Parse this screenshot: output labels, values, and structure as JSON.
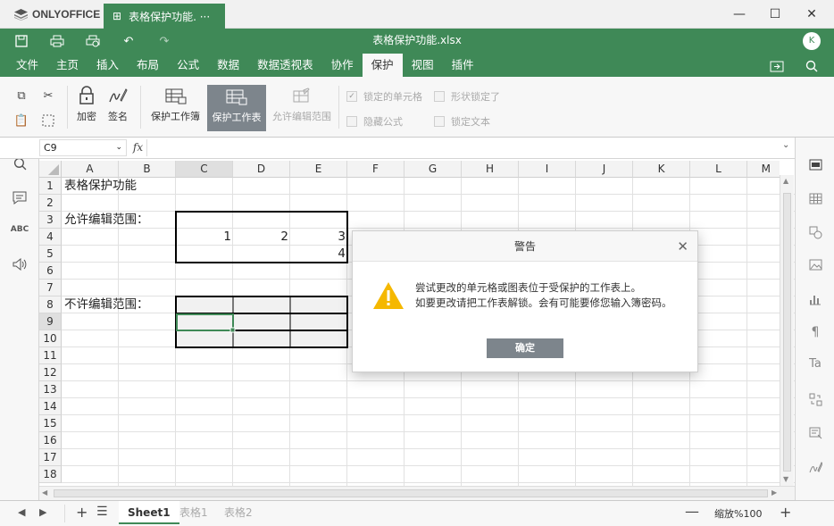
{
  "app": {
    "name": "ONLYOFFICE"
  },
  "doc_tab": {
    "label": "表格保护功能. ···"
  },
  "header": {
    "title": "表格保护功能.xlsx",
    "avatar": "K"
  },
  "menu_tabs": [
    "文件",
    "主页",
    "插入",
    "布局",
    "公式",
    "数据",
    "数据透视表",
    "协作",
    "保护",
    "视图",
    "插件"
  ],
  "active_tab": "保护",
  "toolbar": {
    "encrypt": "加密",
    "signature": "签名",
    "protect_workbook": "保护工作簿",
    "protect_sheet": "保护工作表",
    "allow_edit_ranges": "允许编辑范围",
    "locked_cell": "锁定的单元格",
    "hidden_formula": "隐藏公式",
    "shape_locked": "形状锁定了",
    "lock_text": "锁定文本"
  },
  "formula_bar": {
    "cell_ref": "C9",
    "fx": "fx",
    "value": ""
  },
  "columns": [
    "A",
    "B",
    "C",
    "D",
    "E",
    "F",
    "G",
    "H",
    "I",
    "J",
    "K",
    "L",
    "M"
  ],
  "rows": [
    "1",
    "2",
    "3",
    "4",
    "5",
    "6",
    "7",
    "8",
    "9",
    "10",
    "11",
    "12",
    "13",
    "14",
    "15",
    "16",
    "17",
    "18"
  ],
  "cells": {
    "A1": "表格保护功能",
    "A3": "允许编辑范围：",
    "C4": "1",
    "D4": "2",
    "E4": "3",
    "E5": "4",
    "A8": "不许编辑范围："
  },
  "sheets": [
    "Sheet1",
    "表格1",
    "表格2"
  ],
  "active_sheet": "Sheet1",
  "zoom": {
    "label": "缩放%100"
  },
  "dialog": {
    "title": "警告",
    "line1": "尝试更改的单元格或图表位于受保护的工作表上。",
    "line2": "如要更改请把工作表解锁。会有可能要修您输入簿密码。",
    "ok": "确定"
  },
  "colors": {
    "brand": "#3f8957",
    "active_button": "#7d858c",
    "warning": "#f5b800"
  }
}
